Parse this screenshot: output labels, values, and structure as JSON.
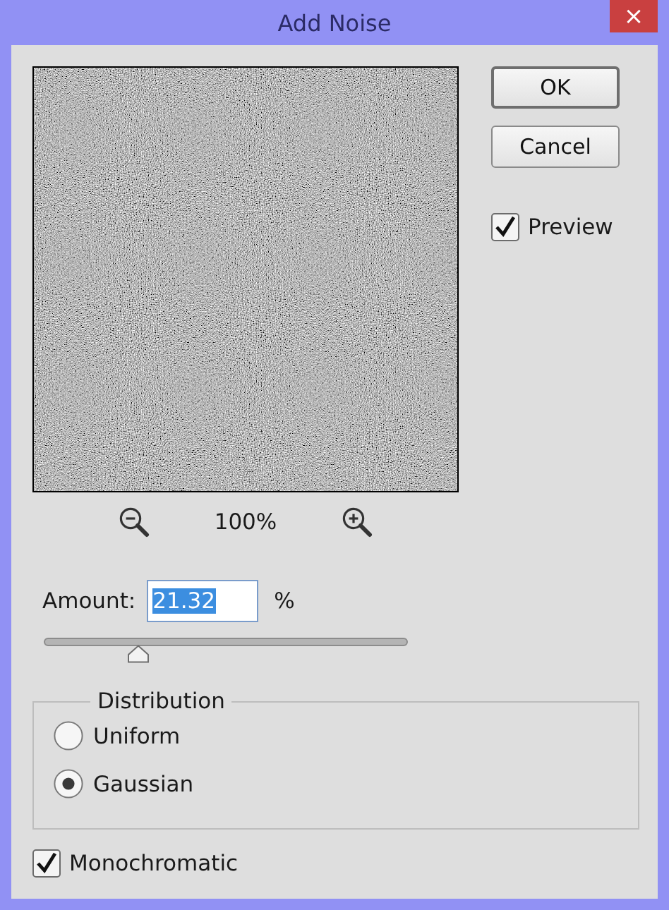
{
  "window": {
    "title": "Add Noise",
    "close": "×"
  },
  "buttons": [
    {
      "label": "OK",
      "default": true
    },
    {
      "label": "Cancel",
      "default": false
    }
  ],
  "preview": {
    "label": "Preview",
    "checked": true
  },
  "zoom": {
    "value": "100%"
  },
  "amount": {
    "label": "Amount:",
    "value": "21.32",
    "selected": true,
    "unit": "%"
  },
  "slider": {
    "level": 0.26
  },
  "distribution": {
    "title": "Distribution",
    "options": [
      {
        "label": "Uniform",
        "selected": false
      },
      {
        "label": "Gaussian",
        "selected": true
      }
    ]
  },
  "monochromatic": {
    "label": "Monochromatic",
    "checked": true
  }
}
